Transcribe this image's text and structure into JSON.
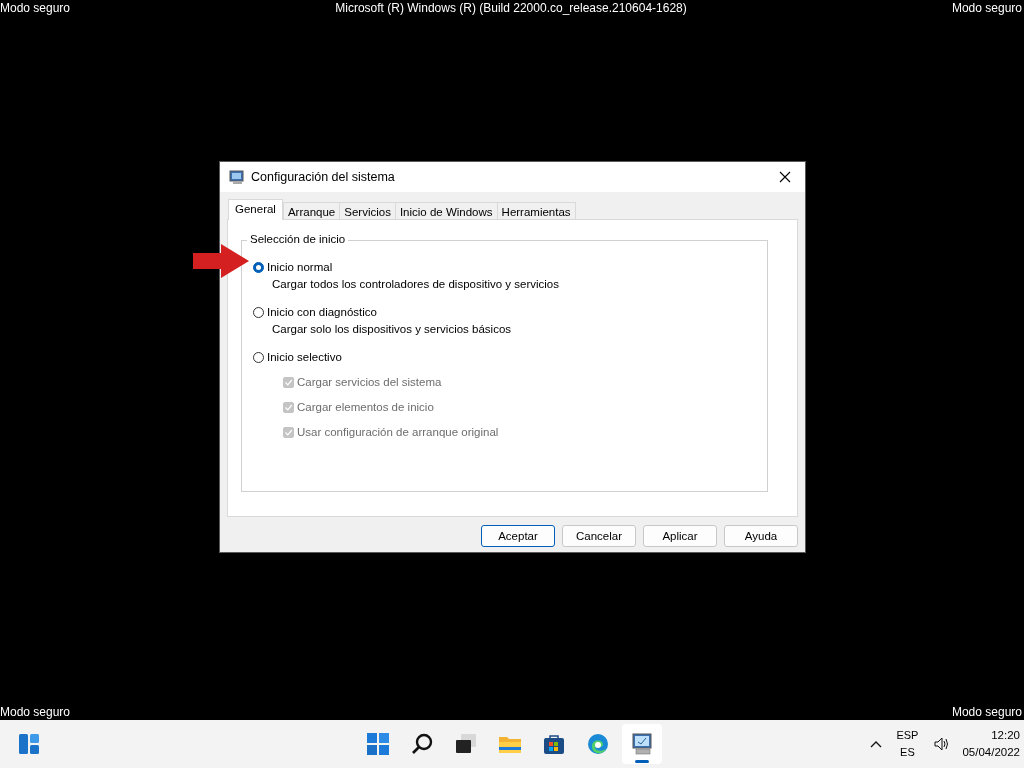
{
  "overlay": {
    "top_left": "Modo seguro",
    "top_center": "Microsoft (R) Windows (R) (Build 22000.co_release.210604-1628)",
    "top_right": "Modo seguro",
    "bottom_left": "Modo seguro",
    "bottom_right": "Modo seguro"
  },
  "window": {
    "title": "Configuración del sistema"
  },
  "tabs": [
    {
      "label": "General",
      "selected": true
    },
    {
      "label": "Arranque",
      "selected": false
    },
    {
      "label": "Servicios",
      "selected": false
    },
    {
      "label": "Inicio de Windows",
      "selected": false
    },
    {
      "label": "Herramientas",
      "selected": false
    }
  ],
  "startup_group": {
    "title": "Selección de inicio",
    "options": [
      {
        "label": "Inicio normal",
        "description": "Cargar todos los controladores de dispositivo y servicios",
        "selected": true
      },
      {
        "label": "Inicio con diagnóstico",
        "description": "Cargar solo los dispositivos y servicios básicos",
        "selected": false
      },
      {
        "label": "Inicio selectivo",
        "selected": false
      }
    ],
    "checkboxes": [
      {
        "label": "Cargar servicios del sistema",
        "checked": true,
        "disabled": true
      },
      {
        "label": "Cargar elementos de inicio",
        "checked": true,
        "disabled": true
      },
      {
        "label": "Usar configuración de arranque original",
        "checked": true,
        "disabled": true
      }
    ]
  },
  "buttons": [
    {
      "label": "Aceptar",
      "default": true
    },
    {
      "label": "Cancelar",
      "default": false
    },
    {
      "label": "Aplicar",
      "default": false
    },
    {
      "label": "Ayuda",
      "default": false
    }
  ],
  "taskbar": {
    "widgets": {
      "kind": "widgets"
    },
    "apps": [
      {
        "kind": "start",
        "selected": false
      },
      {
        "kind": "search",
        "selected": false
      },
      {
        "kind": "taskview",
        "selected": false
      },
      {
        "kind": "folder",
        "selected": false
      },
      {
        "kind": "store",
        "selected": false
      },
      {
        "kind": "browser",
        "selected": false
      },
      {
        "kind": "msconfig",
        "selected": true
      }
    ],
    "language": "ESP",
    "layout": "ES",
    "time": "12:20",
    "date": "05/04/2022"
  }
}
